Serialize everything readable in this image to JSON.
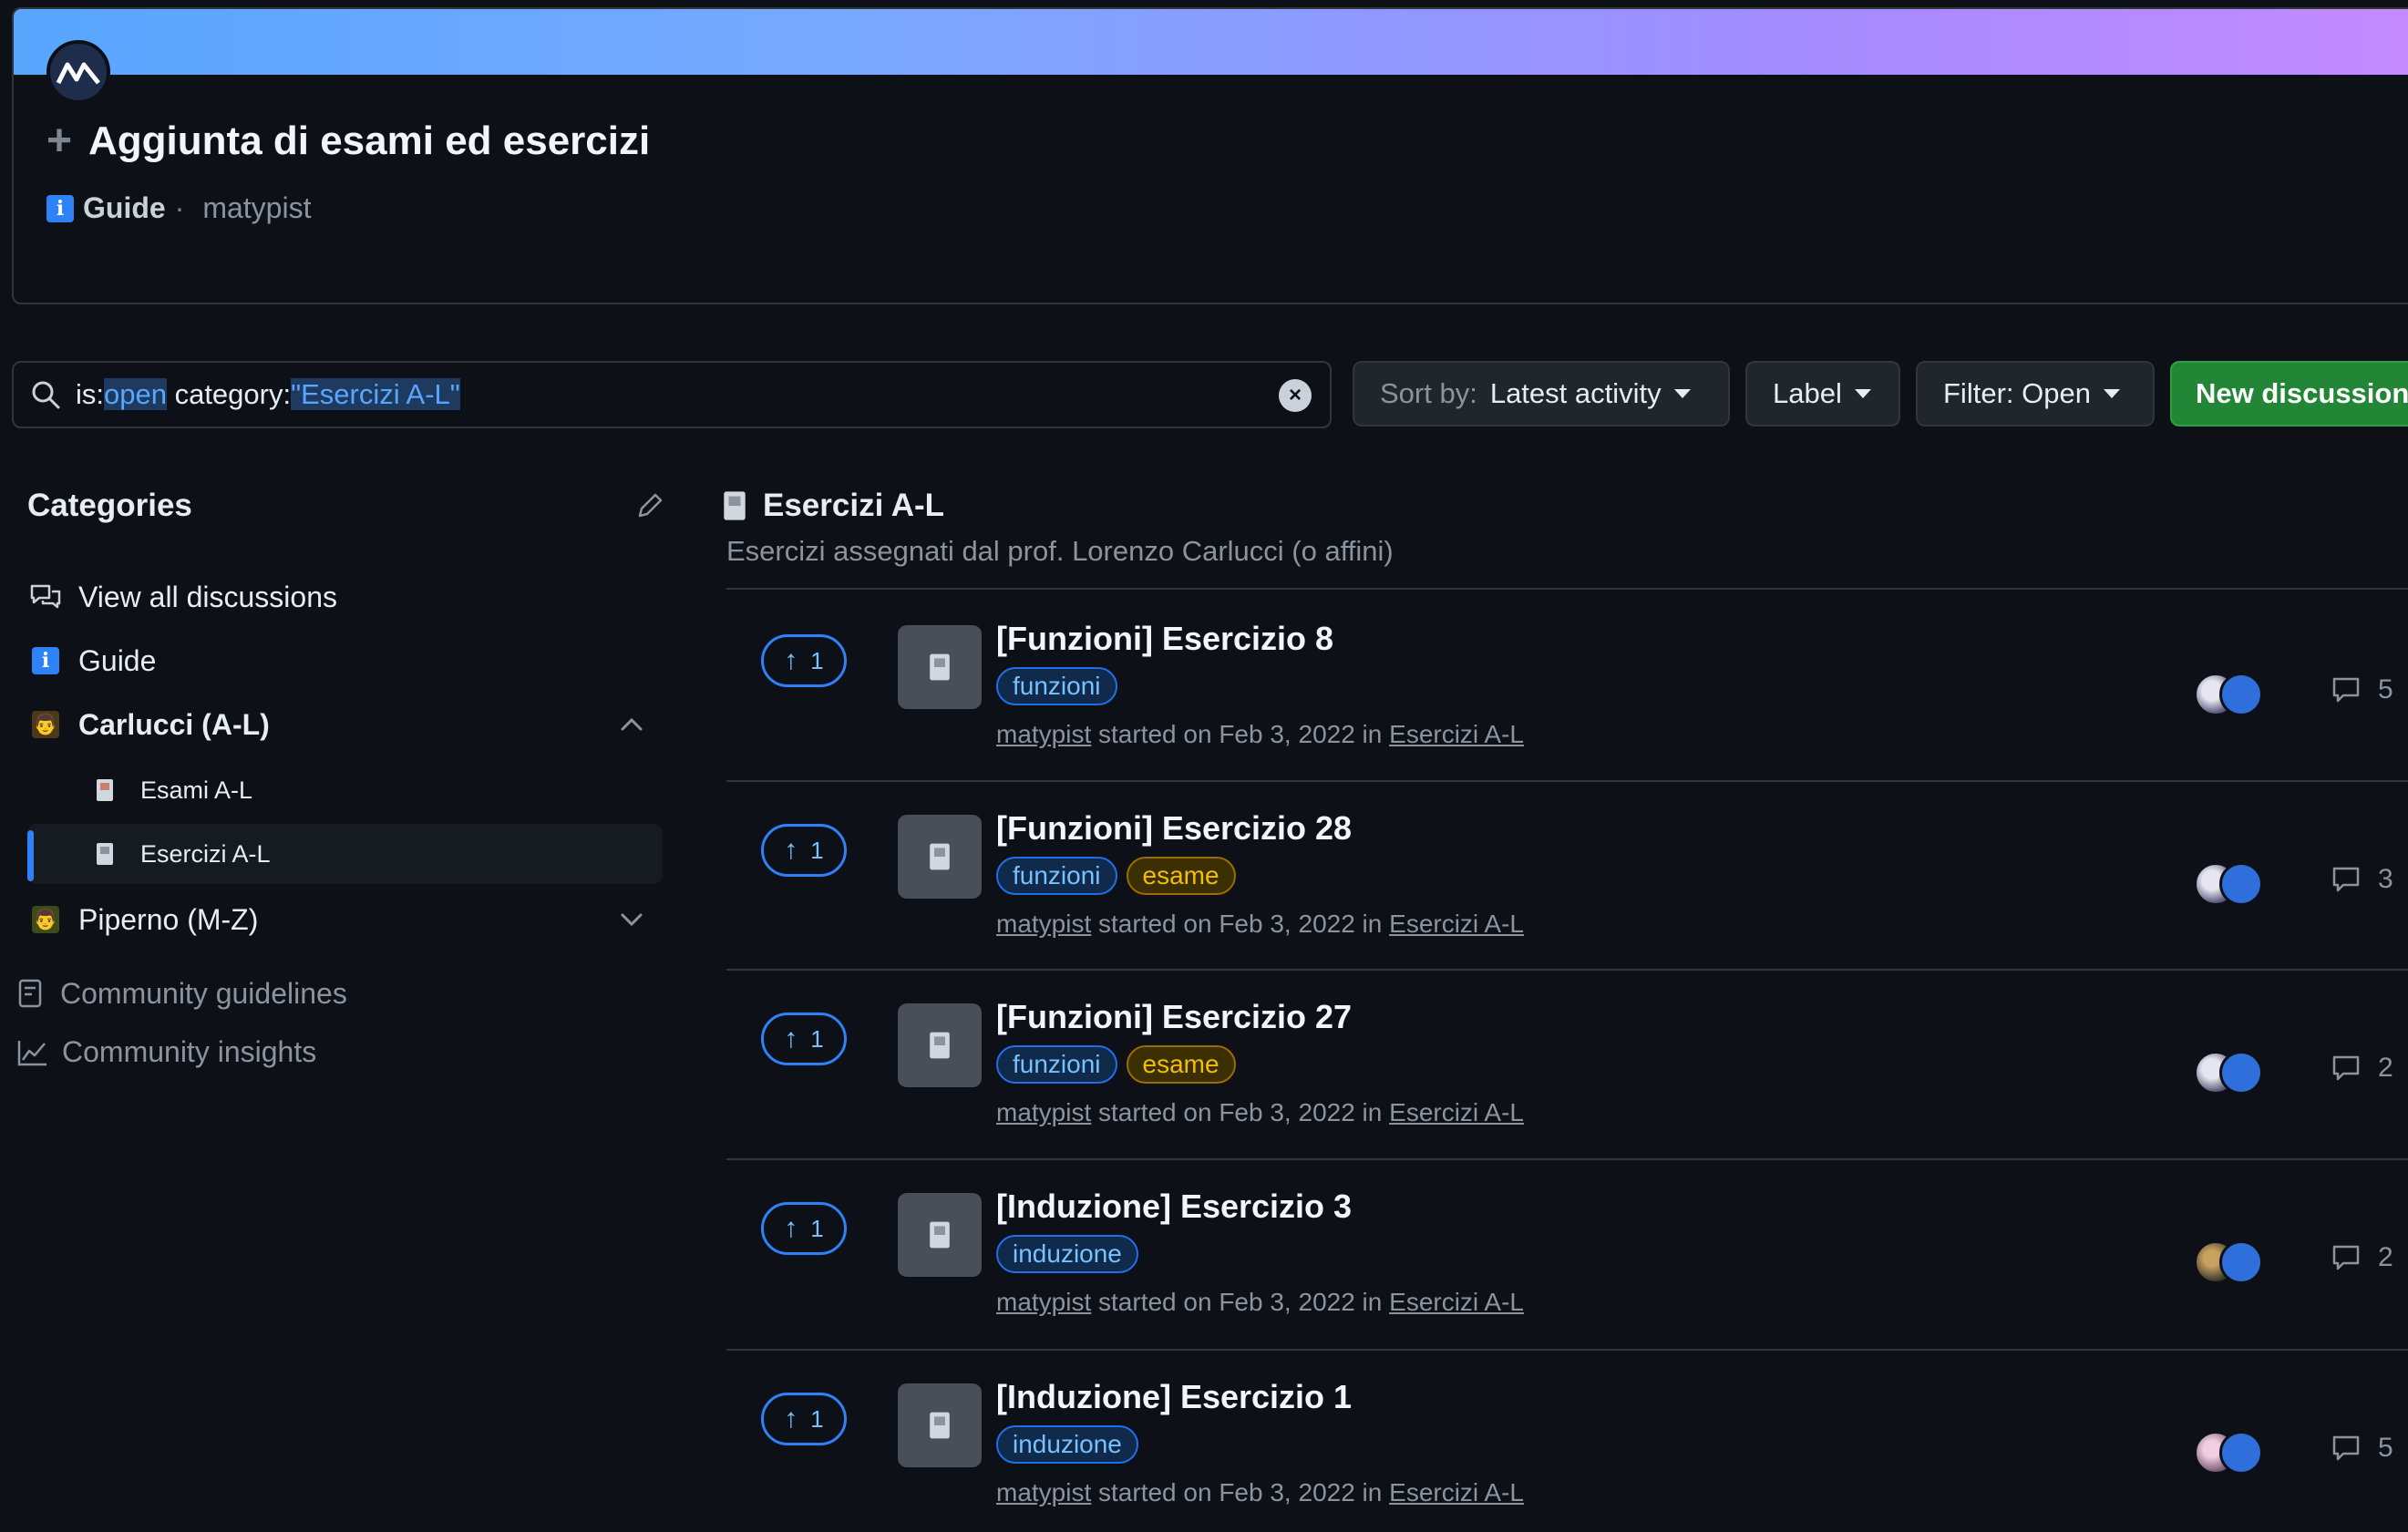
{
  "pinned": {
    "title": "Aggiunta di esami ed esercizi",
    "category": "Guide",
    "separator": "·",
    "author": "matypist",
    "info_glyph": "i"
  },
  "toolbar": {
    "search_prefix": "is:",
    "search_open": "open",
    "search_mid": " category:",
    "search_cat": "\"Esercizi A-L\"",
    "sort_prefix": "Sort by:",
    "sort_value": "Latest activity",
    "label_button": "Label",
    "filter_button": "Filter: Open",
    "new_discussion": "New discussion"
  },
  "sidebar": {
    "title": "Categories",
    "items": [
      {
        "label": "View all discussions"
      },
      {
        "label": "Guide"
      },
      {
        "label": "Carlucci (A-L)"
      },
      {
        "label": "Esami A-L"
      },
      {
        "label": "Esercizi A-L"
      },
      {
        "label": "Piperno (M-Z)"
      }
    ],
    "footer": [
      {
        "label": "Community guidelines"
      },
      {
        "label": "Community insights"
      }
    ]
  },
  "main": {
    "category_title": "Esercizi A-L",
    "category_desc": "Esercizi assegnati dal prof. Lorenzo Carlucci (o affini)",
    "rows": [
      {
        "votes": "1",
        "title": "[Funzioni] Esercizio 8",
        "labels": [
          "funzioni"
        ],
        "author": "matypist",
        "started": " started on Feb 3, 2022 in ",
        "category": "Esercizi A-L",
        "comments": "5"
      },
      {
        "votes": "1",
        "title": "[Funzioni] Esercizio 28",
        "labels": [
          "funzioni",
          "esame"
        ],
        "author": "matypist",
        "started": " started on Feb 3, 2022 in ",
        "category": "Esercizi A-L",
        "comments": "3"
      },
      {
        "votes": "1",
        "title": "[Funzioni] Esercizio 27",
        "labels": [
          "funzioni",
          "esame"
        ],
        "author": "matypist",
        "started": " started on Feb 3, 2022 in ",
        "category": "Esercizi A-L",
        "comments": "2"
      },
      {
        "votes": "1",
        "title": "[Induzione] Esercizio 3",
        "labels": [
          "induzione"
        ],
        "author": "matypist",
        "started": " started on Feb 3, 2022 in ",
        "category": "Esercizi A-L",
        "comments": "2"
      },
      {
        "votes": "1",
        "title": "[Induzione] Esercizio 1",
        "labels": [
          "induzione"
        ],
        "author": "matypist",
        "started": " started on Feb 3, 2022 in ",
        "category": "Esercizi A-L",
        "comments": "5"
      }
    ]
  },
  "colors": {
    "accent": "#2f81f7",
    "new_button": "#238636",
    "label_blue": "#79c0ff",
    "label_yellow": "#f0c000"
  }
}
